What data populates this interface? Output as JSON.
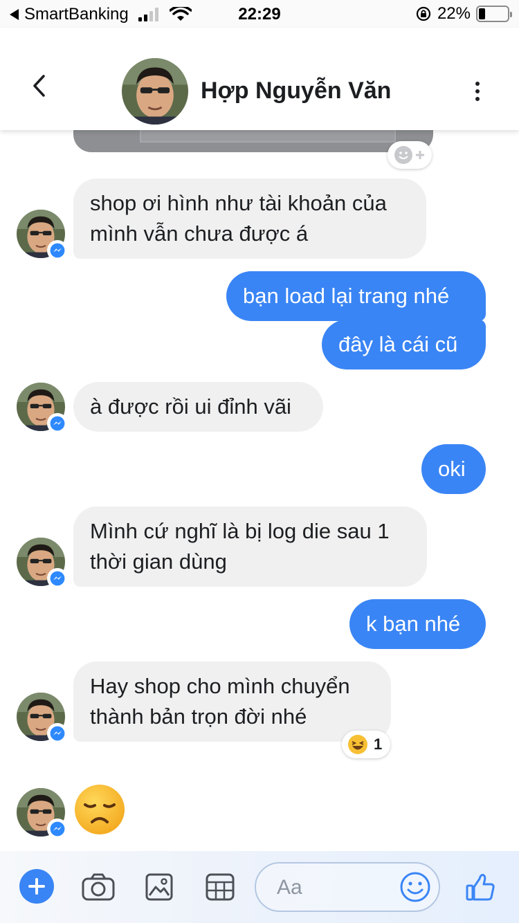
{
  "status_bar": {
    "back_app": "SmartBanking",
    "time": "22:29",
    "battery": "22%",
    "battery_level": 0.22
  },
  "header": {
    "contact_name": "Hợp Nguyễn Văn",
    "icons": [
      "chevron-left-icon",
      "more-vertical-icon"
    ]
  },
  "messages": [
    {
      "from": "contact",
      "text": "shop ơi hình như tài khoản của mình vẫn chưa được á"
    },
    {
      "from": "me",
      "text": "bạn load lại trang nhé"
    },
    {
      "from": "me",
      "text": "đây là cái cũ"
    },
    {
      "from": "contact",
      "text": "à được rồi ui đỉnh vãi"
    },
    {
      "from": "me",
      "text": "oki"
    },
    {
      "from": "contact",
      "text": "Mình cứ nghĩ là bị log die sau 1 thời gian dùng"
    },
    {
      "from": "me",
      "text": "k bạn nhé"
    },
    {
      "from": "contact",
      "text": "Hay shop cho mình chuyển thành bản trọn đời nhé",
      "reaction": {
        "emoji": "laughing-emoji",
        "count": "1"
      }
    },
    {
      "from": "contact",
      "emoji": "disappointed-face-emoji"
    }
  ],
  "composer": {
    "placeholder": "Aa",
    "icons": [
      "plus-icon",
      "camera-icon",
      "image-icon",
      "sticker-icon",
      "emoji-icon",
      "thumbs-up-icon"
    ]
  },
  "colors": {
    "outgoing_bubble": "#3a85f5",
    "incoming_bubble": "#f0f0f0",
    "accent": "#3a85f5"
  }
}
